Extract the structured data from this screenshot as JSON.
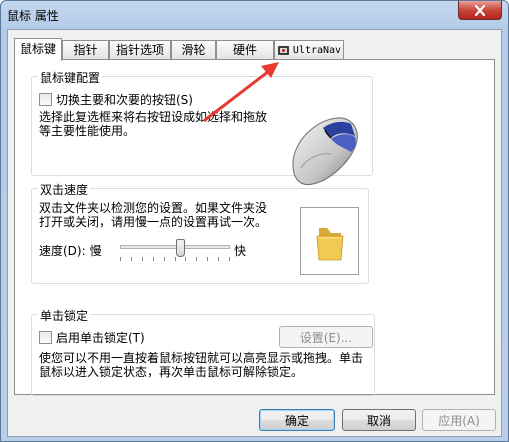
{
  "window": {
    "title": "鼠标 属性"
  },
  "tabs": [
    {
      "label": "鼠标键",
      "active": true
    },
    {
      "label": "指针",
      "active": false
    },
    {
      "label": "指针选项",
      "active": false
    },
    {
      "label": "滑轮",
      "active": false
    },
    {
      "label": "硬件",
      "active": false
    },
    {
      "label": "UltraNav",
      "active": false,
      "icon": "trackpoint-icon"
    }
  ],
  "button_config": {
    "title": "鼠标键配置",
    "switch_label": "切换主要和次要的按钮(S)",
    "switch_checked": false,
    "description_lines": [
      "选择此复选框来将右按钮设成如选择和拖放",
      "等主要性能使用。"
    ]
  },
  "double_click": {
    "title": "双击速度",
    "description_lines": [
      "双击文件夹以检测您的设置。如果文件夹没",
      "打开或关闭，请用慢一点的设置再试一次。"
    ],
    "speed_label": "速度(D):",
    "slow_label": "慢",
    "fast_label": "快",
    "speed_level": 0.55
  },
  "click_lock": {
    "title": "单击锁定",
    "enable_label": "启用单击锁定(T)",
    "enable_checked": false,
    "settings_button": "设置(E)...",
    "description_lines": [
      "使您可以不用一直按着鼠标按钮就可以高亮显示或拖拽。单击",
      "鼠标以进入锁定状态，再次单击鼠标可解除锁定。"
    ]
  },
  "footer": {
    "ok_button": "确定",
    "cancel_button": "取消",
    "apply_button": "应用(A)"
  },
  "colors": {
    "annotation_arrow": "#e83a2e",
    "title_bar": "#b9cfe9"
  }
}
